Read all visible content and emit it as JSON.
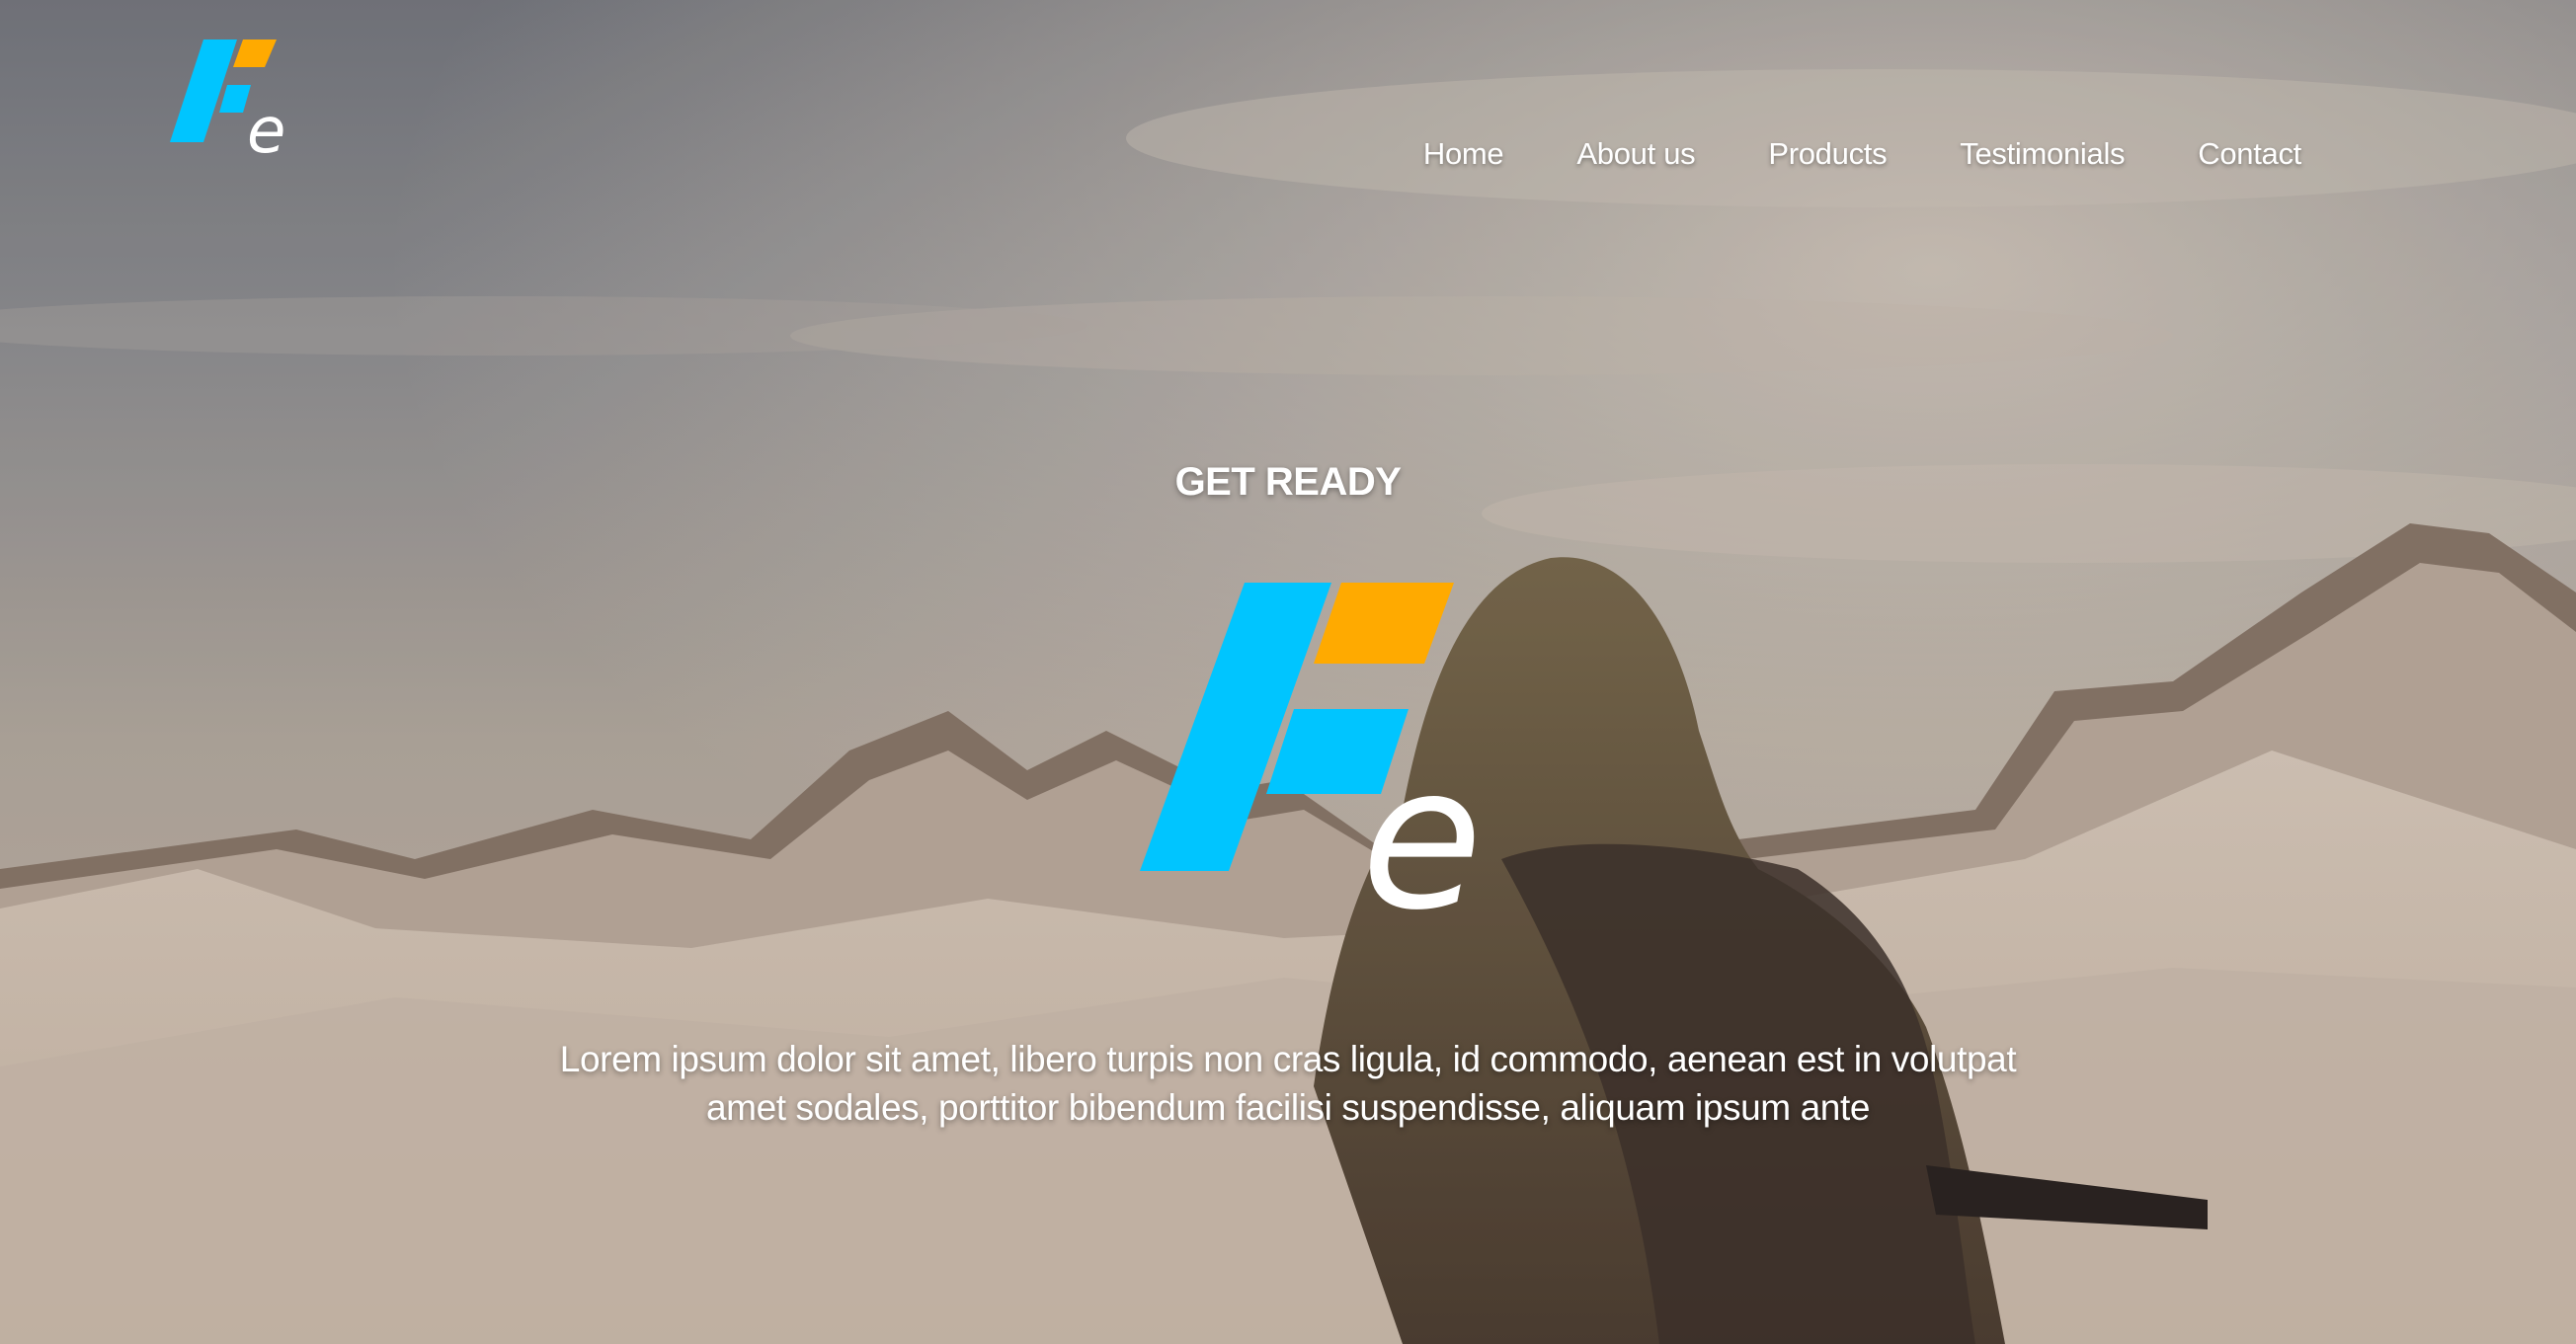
{
  "header": {
    "logo_icon": "fe-logo-icon",
    "nav": [
      {
        "label": "Home"
      },
      {
        "label": "About us"
      },
      {
        "label": "Products"
      },
      {
        "label": "Testimonials"
      },
      {
        "label": "Contact"
      }
    ]
  },
  "hero": {
    "tagline": "GET READY",
    "logo_icon": "fe-logo-icon",
    "text": "Lorem ipsum dolor sit amet, libero turpis non cras ligula, id commodo, aenean est in volutpat amet sodales, porttitor bibendum facilisi suspendisse, aliquam ipsum ante"
  },
  "colors": {
    "logo_blue": "#00c5ff",
    "logo_orange": "#ffaa00",
    "text": "#ffffff"
  }
}
